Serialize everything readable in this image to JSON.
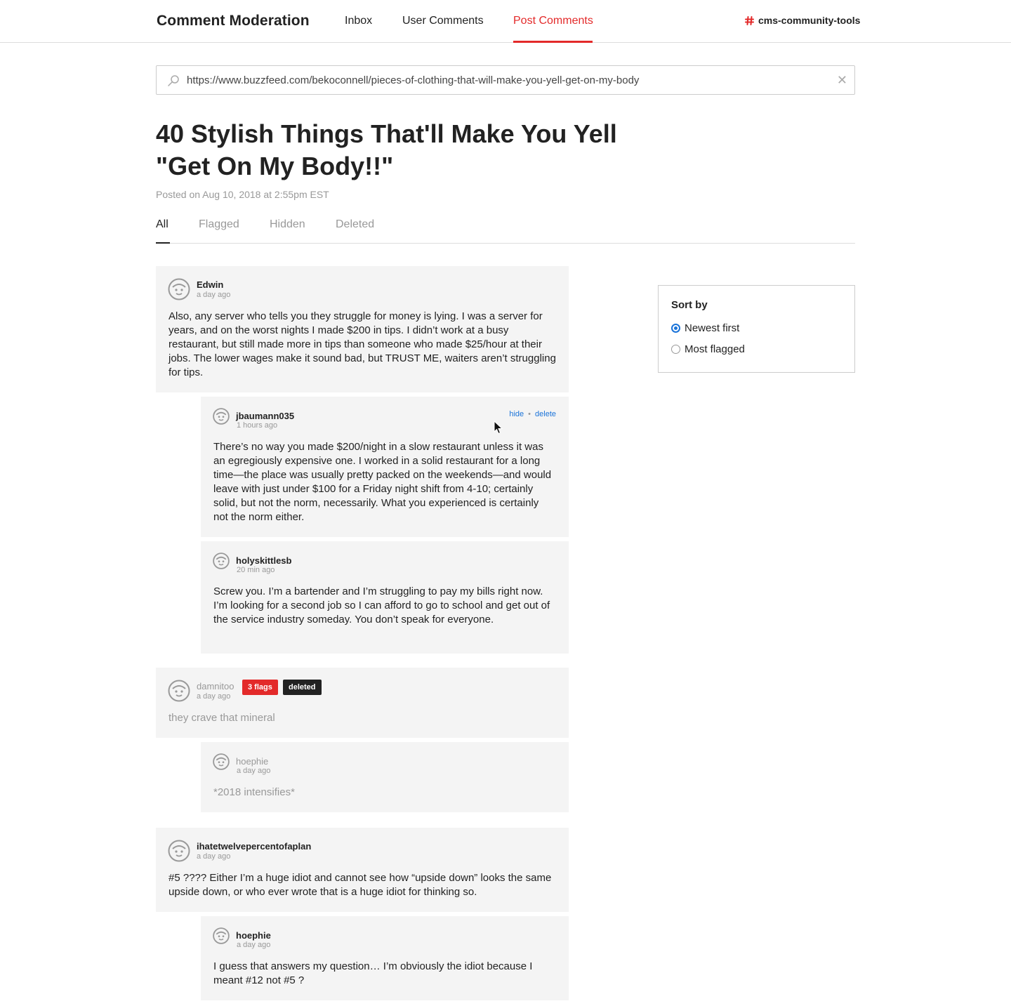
{
  "nav": {
    "brand": "Comment Moderation",
    "links": [
      "Inbox",
      "User Comments",
      "Post Comments"
    ],
    "active_link": "Post Comments",
    "org": "cms-community-tools",
    "accent_color": "#e32a2a"
  },
  "search": {
    "value": "https://www.buzzfeed.com/bekoconnell/pieces-of-clothing-that-will-make-you-yell-get-on-my-body",
    "clear_label": "✕"
  },
  "post": {
    "title": "40 Stylish Things That'll Make You Yell \"Get On My Body!!\"",
    "posted": "Posted on Aug 10, 2018 at 2:55pm EST"
  },
  "tabs": [
    "All",
    "Flagged",
    "Hidden",
    "Deleted"
  ],
  "active_tab": "All",
  "comments": [
    {
      "user": "Edwin",
      "time": "a day ago",
      "text": "Also, any server who tells you they struggle for money is lying. I was a server for years, and on the worst nights I made $200 in tips. I didn’t work at a busy restaurant, but still made more in tips than someone who made $25/hour at their jobs. The lower wages make it sound bad, but TRUST ME, waiters aren’t struggling for tips."
    },
    {
      "user": "jbaumann035",
      "time": "1 hours ago",
      "text": "There’s no way you made $200/night in a slow restaurant unless it was an egregiously expensive one. I worked in a solid restaurant for a long time—the place was usually pretty packed on the weekends—and would leave with just under $100 for a Friday night shift from 4-10; certainly solid, but not the norm, necessarily. What you experienced is certainly not the norm either.",
      "actions": [
        "hide",
        "delete"
      ],
      "action_separator": "•"
    },
    {
      "user": "holyskittlesb",
      "time": "20 min ago",
      "text": "Screw you. I’m a bartender and I’m struggling to pay my bills right now. I’m looking for a second job so I can afford to go to school and get out of the service industry someday. You don’t speak for everyone."
    },
    {
      "user": "damnitoo",
      "time": "a day ago",
      "text": "they crave that mineral",
      "badges": [
        "3 flags",
        "deleted"
      ]
    },
    {
      "user": "hoephie",
      "time": "a day ago",
      "text": "*2018 intensifies*"
    },
    {
      "user": "ihatetwelvepercentofaplan",
      "time": "a day ago",
      "text": "#5 ???? Either I’m a huge idiot and cannot see how “upside down” looks the same upside down, or who ever wrote that is a huge idiot for thinking so."
    },
    {
      "user": "hoephie",
      "time": "a day ago",
      "text": "I guess that answers my question… I’m obviously the idiot because I meant #12 not #5 ?"
    }
  ],
  "sort": {
    "title": "Sort by",
    "options": [
      "Newest first",
      "Most flagged"
    ],
    "selected": "Newest first",
    "accent_color": "#1a73d9"
  }
}
